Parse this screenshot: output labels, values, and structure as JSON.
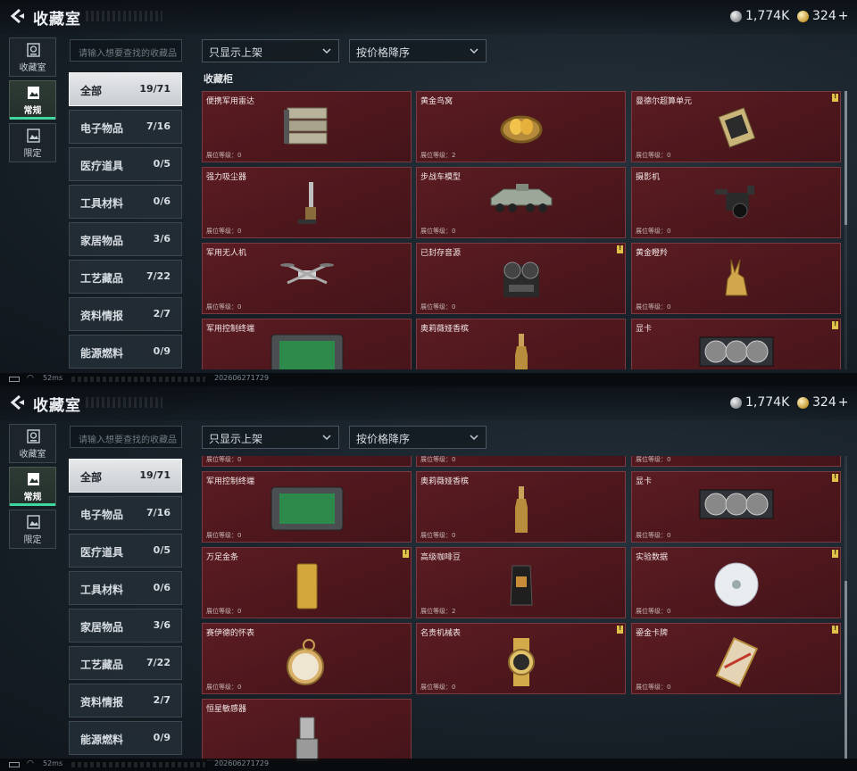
{
  "title": "收藏室",
  "currency": {
    "silver": "1,774K",
    "gold": "324",
    "plus": "+"
  },
  "left_tabs": [
    {
      "label": "收藏室",
      "icon": "vault-icon"
    },
    {
      "label": "常规",
      "icon": "image-frame-icon"
    },
    {
      "label": "限定",
      "icon": "limited-frame-icon"
    }
  ],
  "search": {
    "placeholder": "请输入想要查找的收藏品"
  },
  "filters": {
    "shelf": "只显示上架",
    "sort": "按价格降序"
  },
  "categories": [
    {
      "name": "全部",
      "count": "19/71"
    },
    {
      "name": "电子物品",
      "count": "7/16"
    },
    {
      "name": "医疗道具",
      "count": "0/5"
    },
    {
      "name": "工具材料",
      "count": "0/6"
    },
    {
      "name": "家居物品",
      "count": "3/6"
    },
    {
      "name": "工艺藏品",
      "count": "7/22"
    },
    {
      "name": "资料情报",
      "count": "2/7"
    },
    {
      "name": "能源燃料",
      "count": "0/9"
    }
  ],
  "section_title": "收藏柜",
  "level_label": "展位等级：",
  "items": [
    {
      "name": "便携军用雷达",
      "level": "0",
      "flag": false,
      "icon": "radar-icon"
    },
    {
      "name": "黄金鸟窝",
      "level": "2",
      "flag": false,
      "icon": "golden-nest-icon"
    },
    {
      "name": "曼德尔超算单元",
      "level": "0",
      "flag": true,
      "icon": "compute-unit-icon"
    },
    {
      "name": "强力吸尘器",
      "level": "0",
      "flag": false,
      "icon": "vacuum-icon"
    },
    {
      "name": "步战车模型",
      "level": "0",
      "flag": false,
      "icon": "ifv-model-icon"
    },
    {
      "name": "摄影机",
      "level": "0",
      "flag": false,
      "icon": "camera-icon"
    },
    {
      "name": "军用无人机",
      "level": "0",
      "flag": false,
      "icon": "drone-icon"
    },
    {
      "name": "已封存音源",
      "level": "0",
      "flag": true,
      "icon": "tape-recorder-icon"
    },
    {
      "name": "黄金瞪羚",
      "level": "0",
      "flag": false,
      "icon": "gold-gazelle-icon"
    },
    {
      "name": "军用控制终端",
      "level": "0",
      "flag": false,
      "icon": "control-terminal-icon"
    },
    {
      "name": "奥莉薇娅香槟",
      "level": "0",
      "flag": false,
      "icon": "champagne-icon"
    },
    {
      "name": "显卡",
      "level": "0",
      "flag": true,
      "icon": "gpu-icon"
    },
    {
      "name": "万足金条",
      "level": "0",
      "flag": true,
      "icon": "gold-bar-icon"
    },
    {
      "name": "高级咖啡豆",
      "level": "2",
      "flag": false,
      "icon": "coffee-bag-icon"
    },
    {
      "name": "实验数据",
      "level": "0",
      "flag": true,
      "icon": "disc-icon"
    },
    {
      "name": "赛伊德的怀表",
      "level": "0",
      "flag": false,
      "icon": "pocket-watch-icon"
    },
    {
      "name": "名贵机械表",
      "level": "0",
      "flag": true,
      "icon": "wristwatch-icon"
    },
    {
      "name": "鎏金卡牌",
      "level": "0",
      "flag": true,
      "icon": "gilded-card-icon"
    },
    {
      "name": "恒星敏感器",
      "level": "0",
      "flag": false,
      "icon": "star-sensor-icon"
    }
  ],
  "status": {
    "ping": "52ms",
    "id": "2026062717​29"
  }
}
